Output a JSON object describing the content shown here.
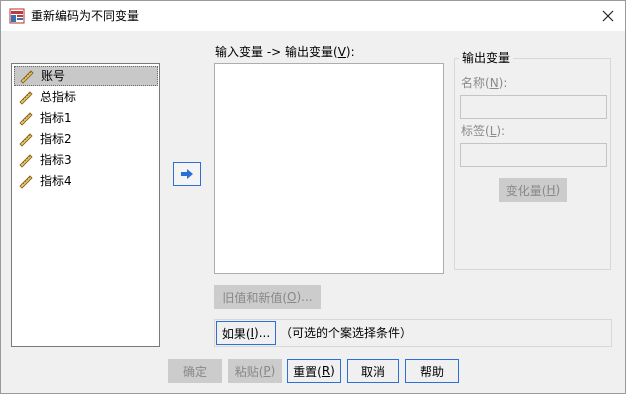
{
  "window": {
    "title": "重新编码为不同变量",
    "icon": "spss-recode-icon",
    "close_icon": "close-icon"
  },
  "variables": [
    {
      "label": "账号",
      "icon": "ruler-icon",
      "selected": true
    },
    {
      "label": "总指标",
      "icon": "ruler-icon",
      "selected": false
    },
    {
      "label": "指标1",
      "icon": "ruler-icon",
      "selected": false
    },
    {
      "label": "指标2",
      "icon": "ruler-icon",
      "selected": false
    },
    {
      "label": "指标3",
      "icon": "ruler-icon",
      "selected": false
    },
    {
      "label": "指标4",
      "icon": "ruler-icon",
      "selected": false
    }
  ],
  "move_button": {
    "icon": "arrow-right-icon"
  },
  "io_list": {
    "label_prefix": "输入变量 -> 输出变量(",
    "label_key": "V",
    "label_suffix": "):"
  },
  "output_group": {
    "title": "输出变量",
    "name": {
      "prefix": "名称(",
      "key": "N",
      "suffix": "):",
      "value": ""
    },
    "label": {
      "prefix": "标签(",
      "key": "L",
      "suffix": "):",
      "value": ""
    },
    "change_button": {
      "prefix": "变化量(",
      "key": "H",
      "suffix": ")"
    }
  },
  "old_new_button": {
    "prefix": "旧值和新值(",
    "key": "O",
    "suffix": ")..."
  },
  "if_button": {
    "prefix": "如果(",
    "key": "I",
    "suffix": ")..."
  },
  "if_description": "（可选的个案选择条件）",
  "footer": {
    "ok": "确定",
    "paste": {
      "prefix": "粘贴(",
      "key": "P",
      "suffix": ")"
    },
    "reset": {
      "prefix": "重置(",
      "key": "R",
      "suffix": ")"
    },
    "cancel": "取消",
    "help": "帮助"
  },
  "colors": {
    "accent": "#2c6fd6",
    "disabled_text": "#8a8a8a",
    "selected_row": "#c8c8c8"
  }
}
